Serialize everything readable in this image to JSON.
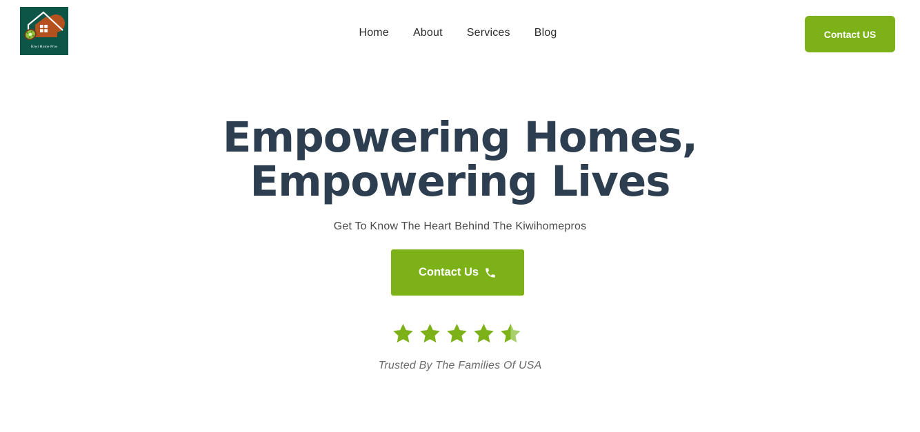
{
  "header": {
    "logo_text": "Kiwi Home Pros",
    "nav": [
      "Home",
      "About",
      "Services",
      "Blog"
    ],
    "cta_label": "Contact US"
  },
  "hero": {
    "title_line1": "Empowering Homes,",
    "title_line2": "Empowering Lives",
    "subtitle": "Get To Know The Heart Behind The Kiwihomepros",
    "cta_label": "Contact Us",
    "cta_icon": "phone-icon",
    "rating": 4.5,
    "rating_max": 5,
    "trusted_text": "Trusted By The Families Of USA"
  },
  "colors": {
    "accent": "#7cb218",
    "heading": "#2c3e50",
    "logo_bg": "#0d5547"
  }
}
